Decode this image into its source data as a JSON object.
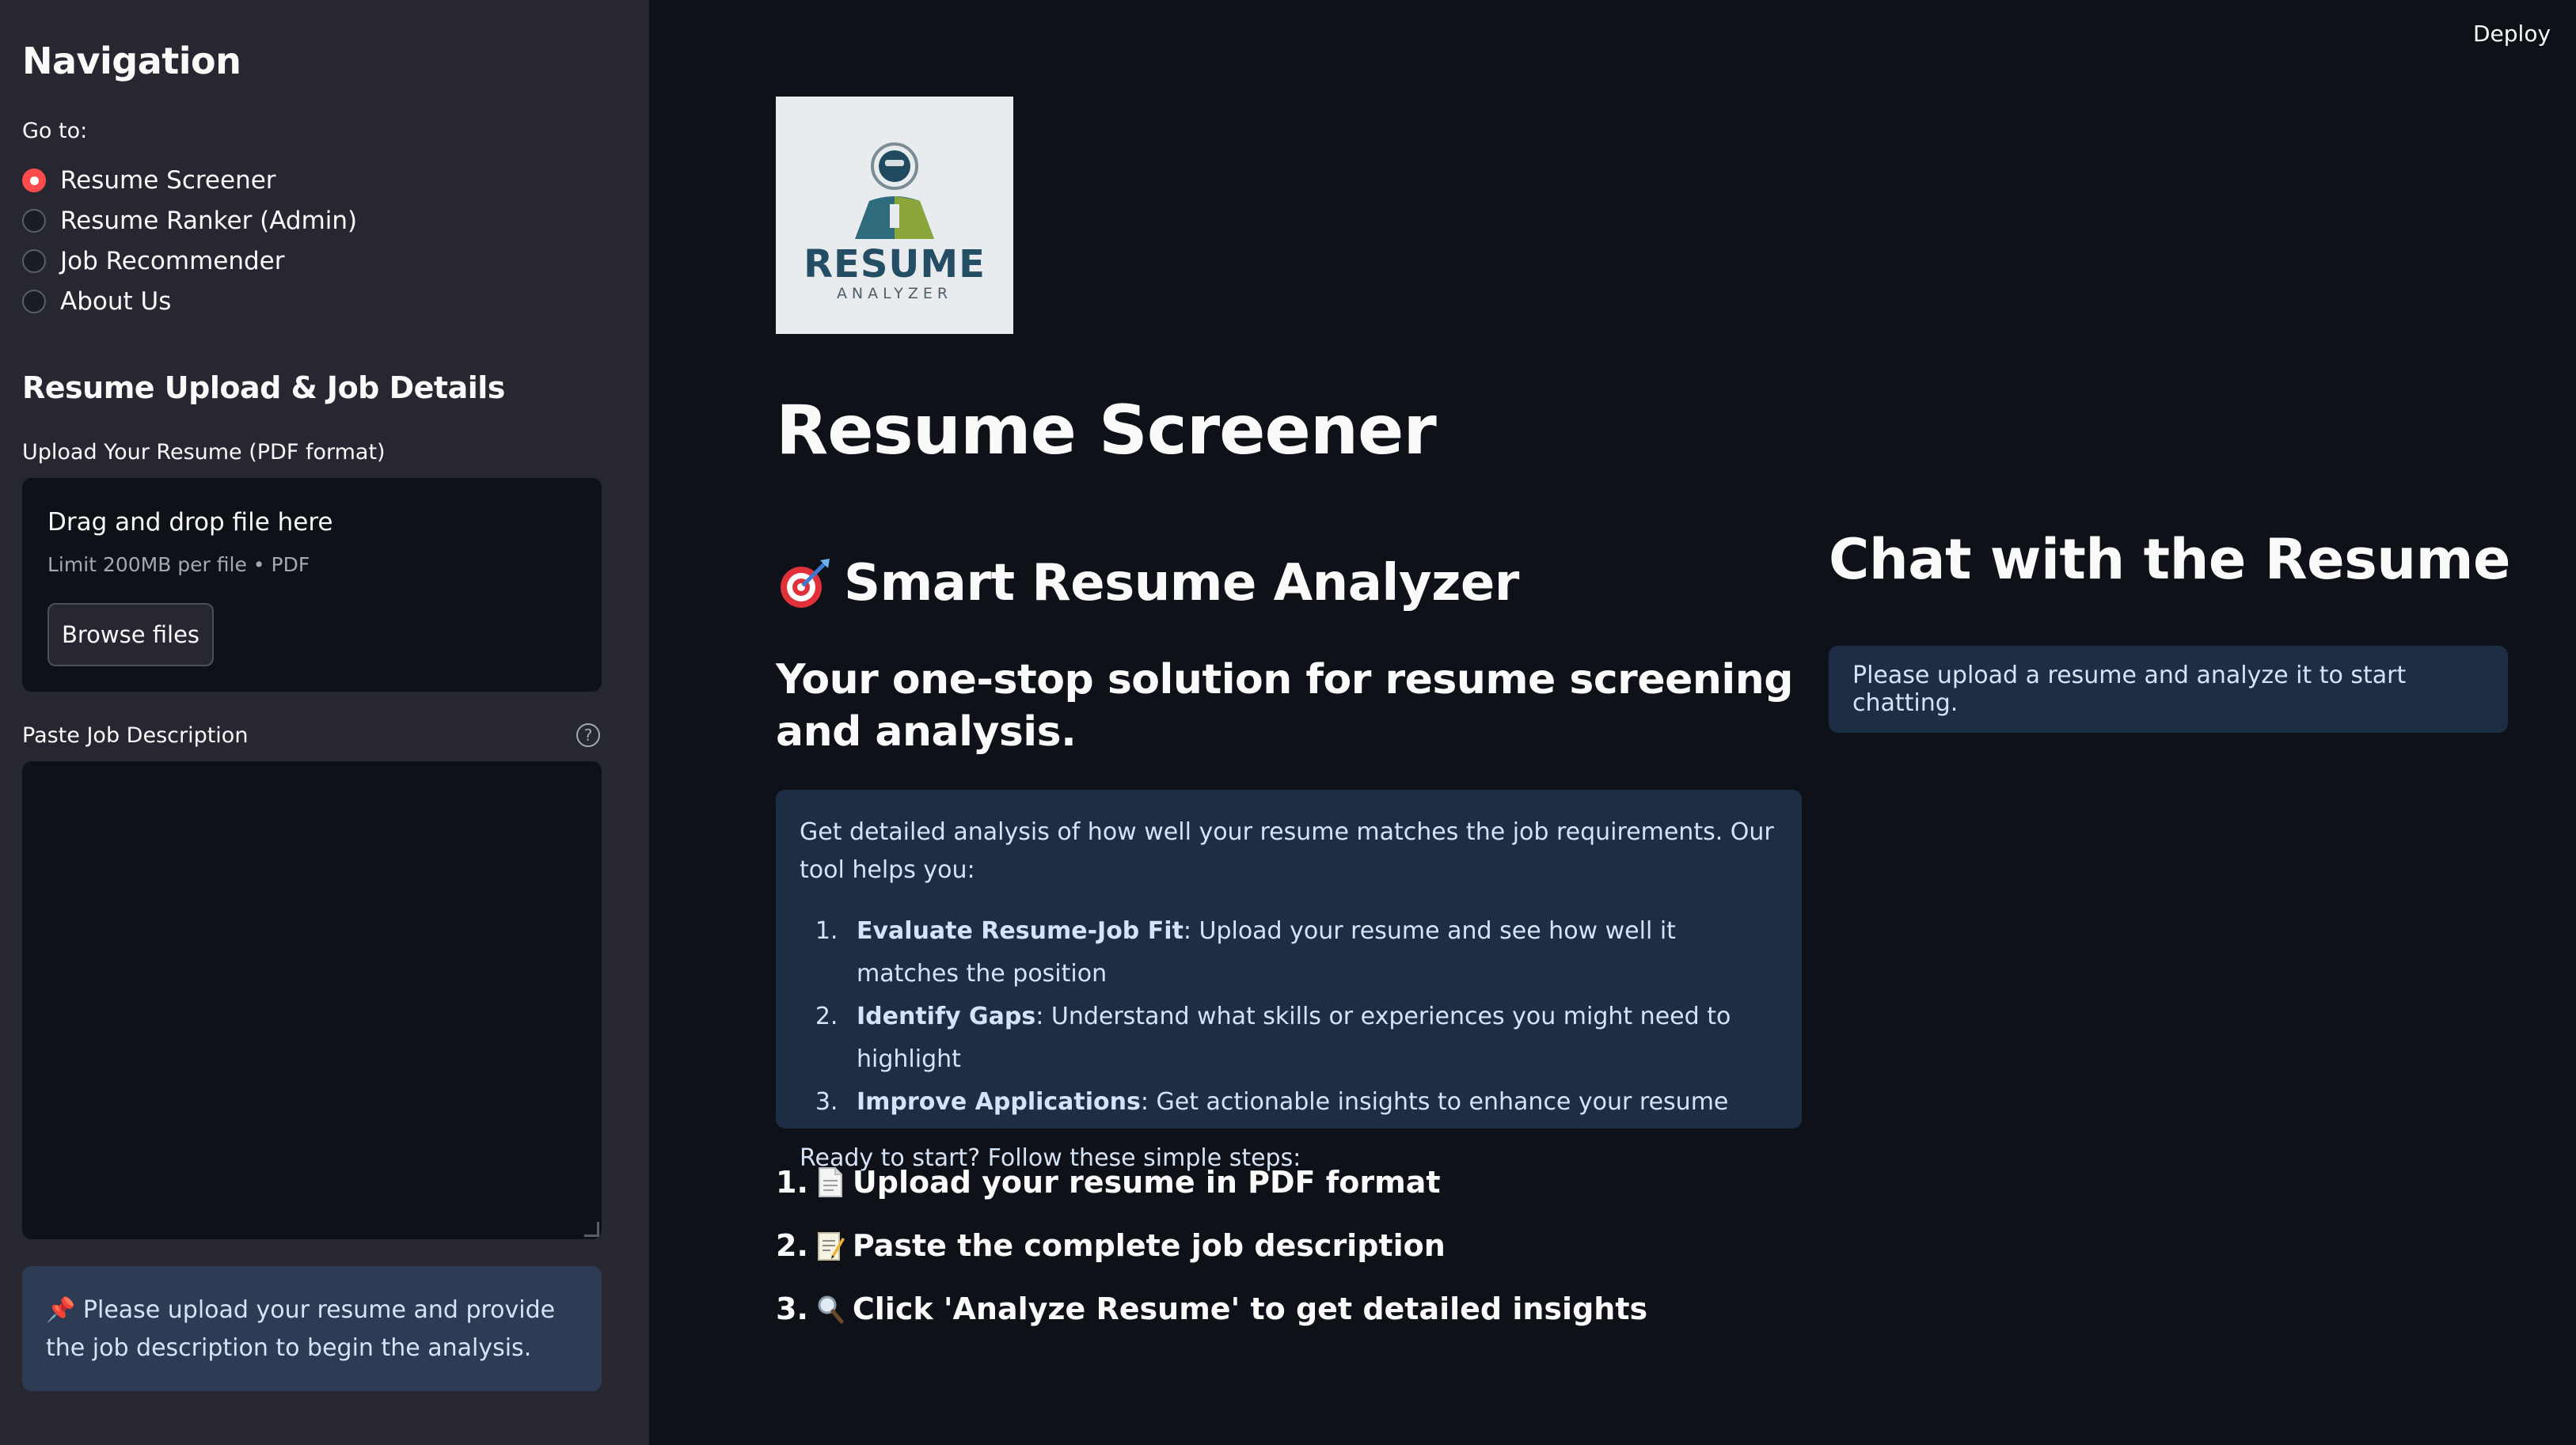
{
  "header": {
    "deploy_label": "Deploy"
  },
  "sidebar": {
    "nav_title": "Navigation",
    "goto_label": "Go to:",
    "nav_options": [
      {
        "label": "Resume Screener",
        "selected": true
      },
      {
        "label": "Resume Ranker (Admin)",
        "selected": false
      },
      {
        "label": "Job Recommender",
        "selected": false
      },
      {
        "label": "About Us",
        "selected": false
      }
    ],
    "section_title": "Resume Upload & Job Details",
    "upload_label": "Upload Your Resume (PDF format)",
    "uploader": {
      "drop_text": "Drag and drop file here",
      "limit_text": "Limit 200MB per file • PDF",
      "browse_label": "Browse files"
    },
    "jd_label": "Paste Job Description",
    "jd_value": "",
    "info_text": "📌 Please upload your resume and provide the job description to begin the analysis."
  },
  "main": {
    "logo": {
      "word": "RESUME",
      "sub": "ANALYZER"
    },
    "page_title": "Resume Screener",
    "analyzer_title": "Smart Resume Analyzer",
    "tagline": "Your one-stop solution for resume screening and analysis.",
    "info": {
      "intro": "Get detailed analysis of how well your resume matches the job requirements. Our tool helps you:",
      "items": [
        {
          "bold": "Evaluate Resume-Job Fit",
          "text": ": Upload your resume and see how well it matches the position"
        },
        {
          "bold": "Identify Gaps",
          "text": ": Understand what skills or experiences you might need to highlight"
        },
        {
          "bold": "Improve Applications",
          "text": ": Get actionable insights to enhance your resume"
        }
      ],
      "ready": "Ready to start? Follow these simple steps:"
    },
    "steps": [
      {
        "num": "1.",
        "icon": "page-icon",
        "text": "Upload your resume in PDF format"
      },
      {
        "num": "2.",
        "icon": "memo-icon",
        "text": "Paste the complete job description"
      },
      {
        "num": "3.",
        "icon": "magnifier-icon",
        "text": "Click 'Analyze Resume' to get detailed insights"
      }
    ]
  },
  "chat": {
    "title": "Chat with the Resume",
    "info_text": "Please upload a resume and analyze it to start chatting."
  },
  "colors": {
    "main_bg": "#0e1117",
    "sidebar_bg": "#262730",
    "accent": "#ff4b4b",
    "info_bg": "#1c2d44",
    "info_text": "#d4e3f5"
  }
}
